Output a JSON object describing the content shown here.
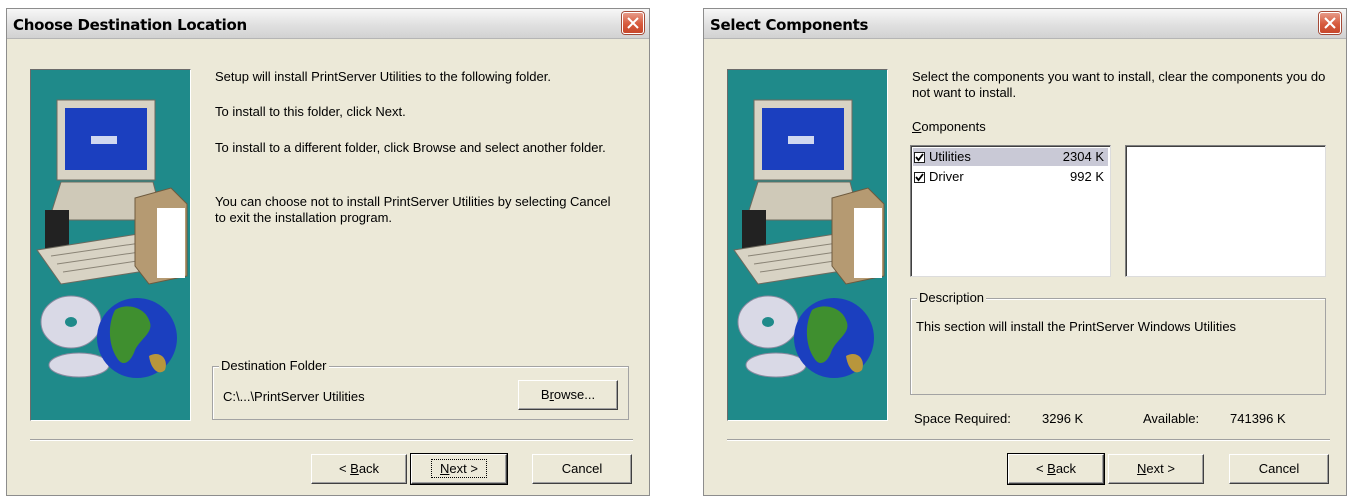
{
  "dialog1": {
    "title": "Choose Destination Location",
    "para1": "Setup will install PrintServer Utilities to the following folder.",
    "para2": "To install to this folder, click Next.",
    "para3": "To install to a different folder, click Browse and select another folder.",
    "para4": "You can choose not to install PrintServer Utilities by selecting Cancel to exit the installation program.",
    "dest_group_label": "Destination Folder",
    "dest_path": "C:\\...\\PrintServer Utilities",
    "browse_pre": "B",
    "browse_ul": "r",
    "browse_post": "owse...",
    "back_prefix": "< ",
    "back_ul": "B",
    "back_rest": "ack",
    "next_ul": "N",
    "next_rest": "ext >",
    "cancel_label": "Cancel"
  },
  "dialog2": {
    "title": "Select Components",
    "intro": "Select the components you want to install, clear the components you do not want to install.",
    "components_label_ul": "C",
    "components_label_rest": "omponents",
    "components": [
      {
        "name": "Utilities",
        "size": "2304 K",
        "checked": true,
        "selected": true
      },
      {
        "name": "Driver",
        "size": "992 K",
        "checked": true,
        "selected": false
      }
    ],
    "description_label": "Description",
    "description_text": "This section will install the PrintServer Windows Utilities",
    "space_required_label": "Space Required:",
    "space_required_value": "3296 K",
    "available_label": "Available:",
    "available_value": "741396 K",
    "back_prefix": "< ",
    "back_ul": "B",
    "back_rest": "ack",
    "next_ul": "N",
    "next_rest": "ext >",
    "cancel_label": "Cancel"
  },
  "icons": {
    "close": "close-icon",
    "art": "computer-globe-illustration",
    "check": "checkmark-icon"
  },
  "colors": {
    "dialog_bg": "#ece9d8",
    "art_bg": "#1f8a8a",
    "close_button": "#d75a3c",
    "selection": "#c9c9d6"
  }
}
